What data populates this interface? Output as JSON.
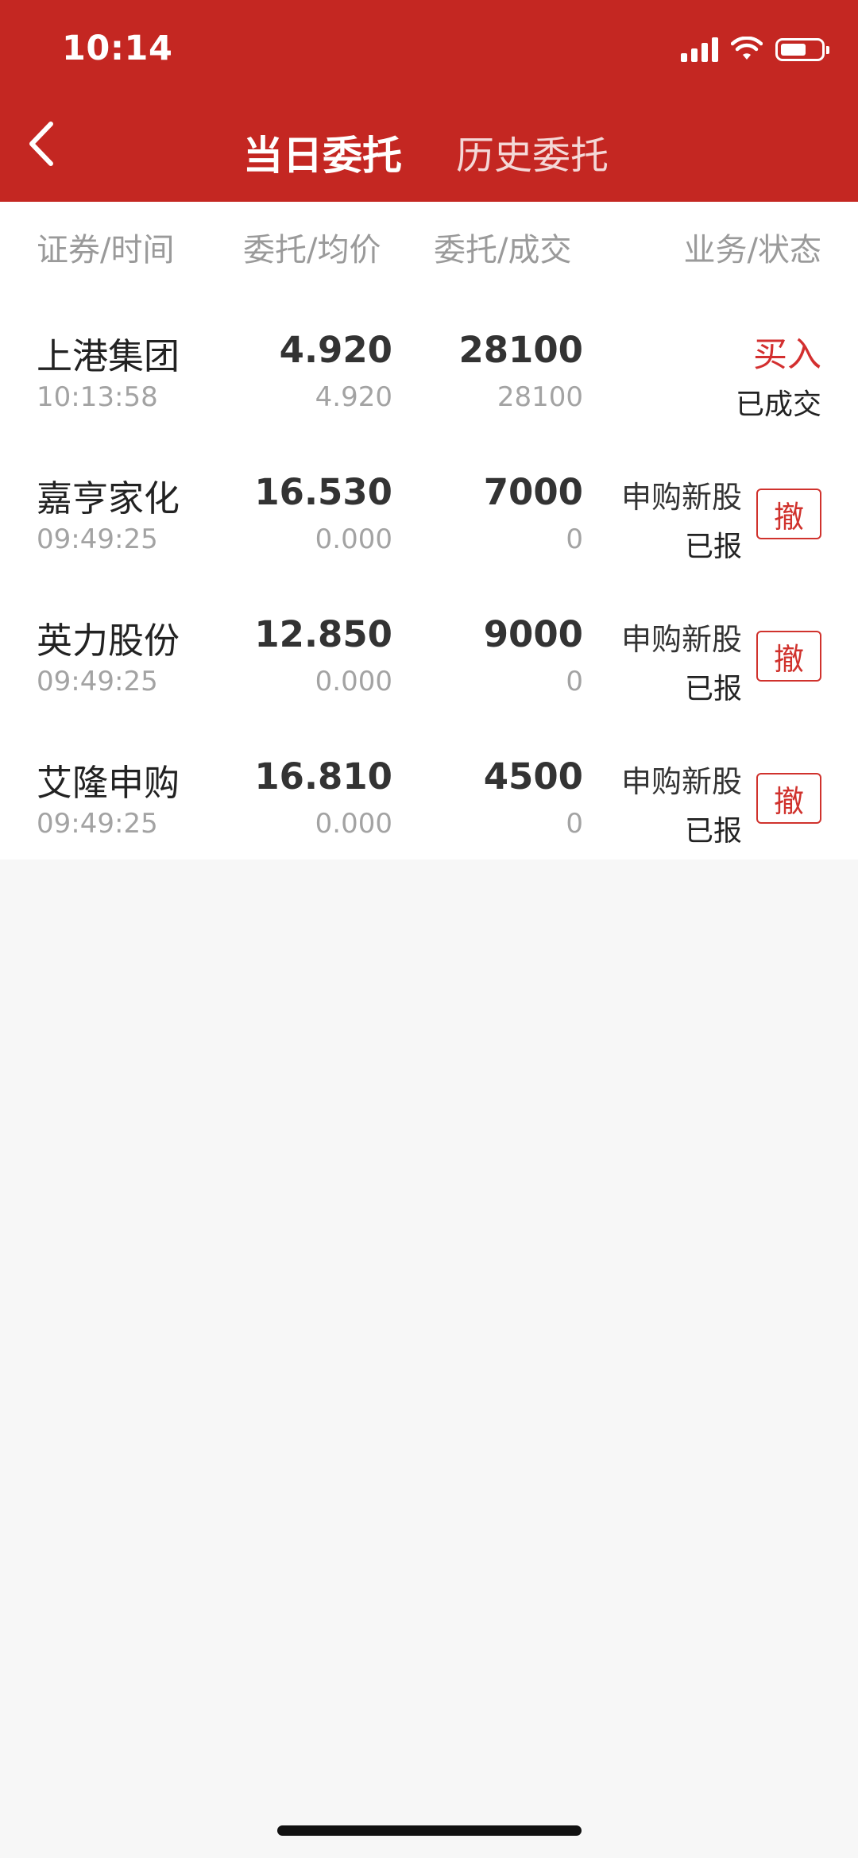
{
  "status_bar": {
    "time": "10:14"
  },
  "nav": {
    "tabs": [
      {
        "label": "当日委托",
        "active": true
      },
      {
        "label": "历史委托",
        "active": false
      }
    ]
  },
  "table": {
    "headers": [
      "证券/时间",
      "委托/均价",
      "委托/成交",
      "业务/状态"
    ],
    "rows": [
      {
        "name": "上港集团",
        "time": "10:13:58",
        "price": "4.920",
        "avg_price": "4.920",
        "qty": "28100",
        "filled": "28100",
        "business": "买入",
        "status": "已成交",
        "cancel_label": null
      },
      {
        "name": "嘉亨家化",
        "time": "09:49:25",
        "price": "16.530",
        "avg_price": "0.000",
        "qty": "7000",
        "filled": "0",
        "business": "申购新股",
        "status": "已报",
        "cancel_label": "撤"
      },
      {
        "name": "英力股份",
        "time": "09:49:25",
        "price": "12.850",
        "avg_price": "0.000",
        "qty": "9000",
        "filled": "0",
        "business": "申购新股",
        "status": "已报",
        "cancel_label": "撤"
      },
      {
        "name": "艾隆申购",
        "time": "09:49:25",
        "price": "16.810",
        "avg_price": "0.000",
        "qty": "4500",
        "filled": "0",
        "business": "申购新股",
        "status": "已报",
        "cancel_label": "撤"
      }
    ]
  },
  "colors": {
    "header_bg": "#c42722",
    "buy_text": "#d32f2f",
    "cancel_border": "#d0322d",
    "page_bg": "#f7f7f7"
  }
}
